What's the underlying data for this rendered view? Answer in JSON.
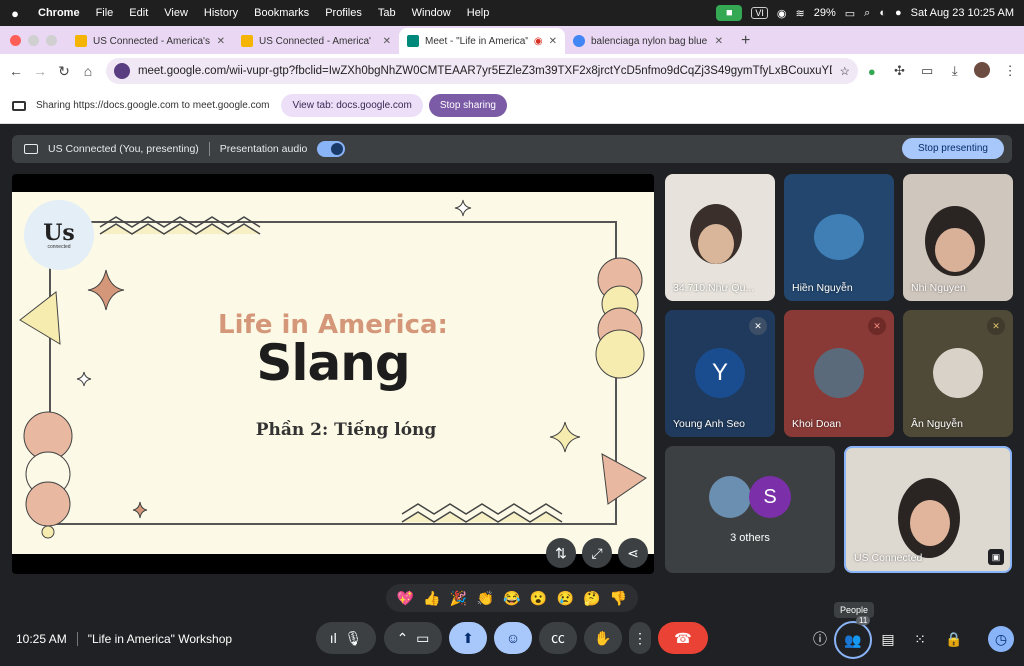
{
  "menubar": {
    "app": "Chrome",
    "items": [
      "File",
      "Edit",
      "View",
      "History",
      "Bookmarks",
      "Profiles",
      "Tab",
      "Window",
      "Help"
    ],
    "vi_badge": "VI",
    "battery": "29%",
    "datetime": "Sat Aug 23  10:25 AM"
  },
  "tabs": [
    {
      "title": "US Connected - America's Cu",
      "favicon_color": "#f4b400"
    },
    {
      "title": "US Connected - America'",
      "favicon_color": "#f4b400"
    },
    {
      "title": "Meet - \"Life in America\" W",
      "favicon_color": "#00897b"
    },
    {
      "title": "balenciaga nylon bag blue - G",
      "favicon_color": "#4285f4"
    }
  ],
  "address_bar": {
    "url": "meet.google.com/wii-vupr-gtp?fbclid=IwZXh0bgNhZW0CMTEAAR7yr5EZleZ3m39TXF2x8jrctYcD5nfmo9dCqZj3S49gymTfyLxBCouxuYD_Lg_aem_6v..."
  },
  "sharing_bar": {
    "text": "Sharing https://docs.google.com to meet.google.com",
    "view_tab_label": "View tab: docs.google.com",
    "stop_sharing_label": "Stop sharing"
  },
  "present_bar": {
    "presenter": "US Connected (You, presenting)",
    "audio_label": "Presentation audio",
    "stop_label": "Stop presenting"
  },
  "slide": {
    "logo_text": "Us",
    "logo_subtext": "connected",
    "title": "Life in America:",
    "heading": "Slang",
    "subtitle": "Phần 2: Tiếng lóng"
  },
  "participants": [
    {
      "name": "34.710.Như Qu...",
      "muted": false
    },
    {
      "name": "Hiền Nguyễn",
      "muted": false
    },
    {
      "name": "Nhi Nguyen",
      "muted": false
    },
    {
      "name": "Young Anh Seo",
      "initial": "Y",
      "muted": true
    },
    {
      "name": "Khoi Doan",
      "muted": true
    },
    {
      "name": "Ân Nguyễn",
      "muted": true
    },
    {
      "name": "US Connected",
      "muted": false
    }
  ],
  "others": {
    "label": "3 others",
    "avatar_initial": "S"
  },
  "reactions": [
    "💖",
    "👍",
    "🎉",
    "👏",
    "😂",
    "😮",
    "😢",
    "🤔",
    "👎"
  ],
  "footer": {
    "time": "10:25 AM",
    "meeting_name": "\"Life in America\" Workshop",
    "people_tooltip": "People",
    "people_count": "11"
  }
}
